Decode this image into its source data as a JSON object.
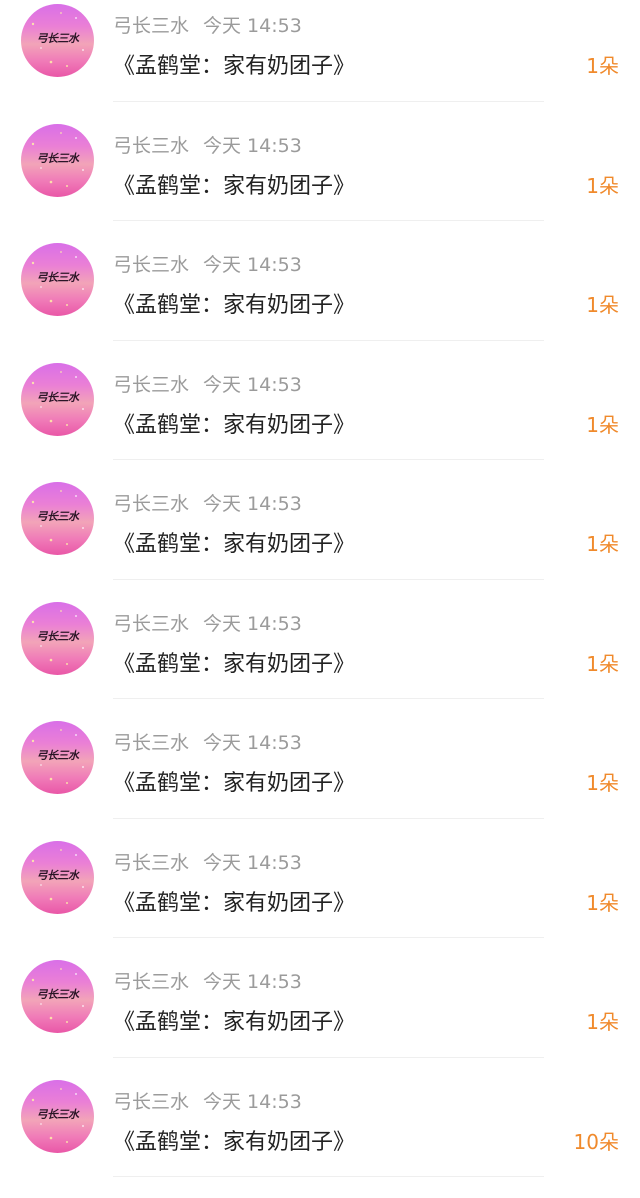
{
  "colors": {
    "username": "#9b9b9b",
    "title": "#222222",
    "amount": "#f08a2c",
    "divider": "#efefef"
  },
  "items": [
    {
      "avatar_text": "弓长三水",
      "username": "弓长三水",
      "time": "今天 14:53",
      "title": "《孟鹤堂：家有奶团子》",
      "amount": "1朵"
    },
    {
      "avatar_text": "弓长三水",
      "username": "弓长三水",
      "time": "今天 14:53",
      "title": "《孟鹤堂：家有奶团子》",
      "amount": "1朵"
    },
    {
      "avatar_text": "弓长三水",
      "username": "弓长三水",
      "time": "今天 14:53",
      "title": "《孟鹤堂：家有奶团子》",
      "amount": "1朵"
    },
    {
      "avatar_text": "弓长三水",
      "username": "弓长三水",
      "time": "今天 14:53",
      "title": "《孟鹤堂：家有奶团子》",
      "amount": "1朵"
    },
    {
      "avatar_text": "弓长三水",
      "username": "弓长三水",
      "time": "今天 14:53",
      "title": "《孟鹤堂：家有奶团子》",
      "amount": "1朵"
    },
    {
      "avatar_text": "弓长三水",
      "username": "弓长三水",
      "time": "今天 14:53",
      "title": "《孟鹤堂：家有奶团子》",
      "amount": "1朵"
    },
    {
      "avatar_text": "弓长三水",
      "username": "弓长三水",
      "time": "今天 14:53",
      "title": "《孟鹤堂：家有奶团子》",
      "amount": "1朵"
    },
    {
      "avatar_text": "弓长三水",
      "username": "弓长三水",
      "time": "今天 14:53",
      "title": "《孟鹤堂：家有奶团子》",
      "amount": "1朵"
    },
    {
      "avatar_text": "弓长三水",
      "username": "弓长三水",
      "time": "今天 14:53",
      "title": "《孟鹤堂：家有奶团子》",
      "amount": "1朵"
    },
    {
      "avatar_text": "弓长三水",
      "username": "弓长三水",
      "time": "今天 14:53",
      "title": "《孟鹤堂：家有奶团子》",
      "amount": "10朵"
    }
  ]
}
